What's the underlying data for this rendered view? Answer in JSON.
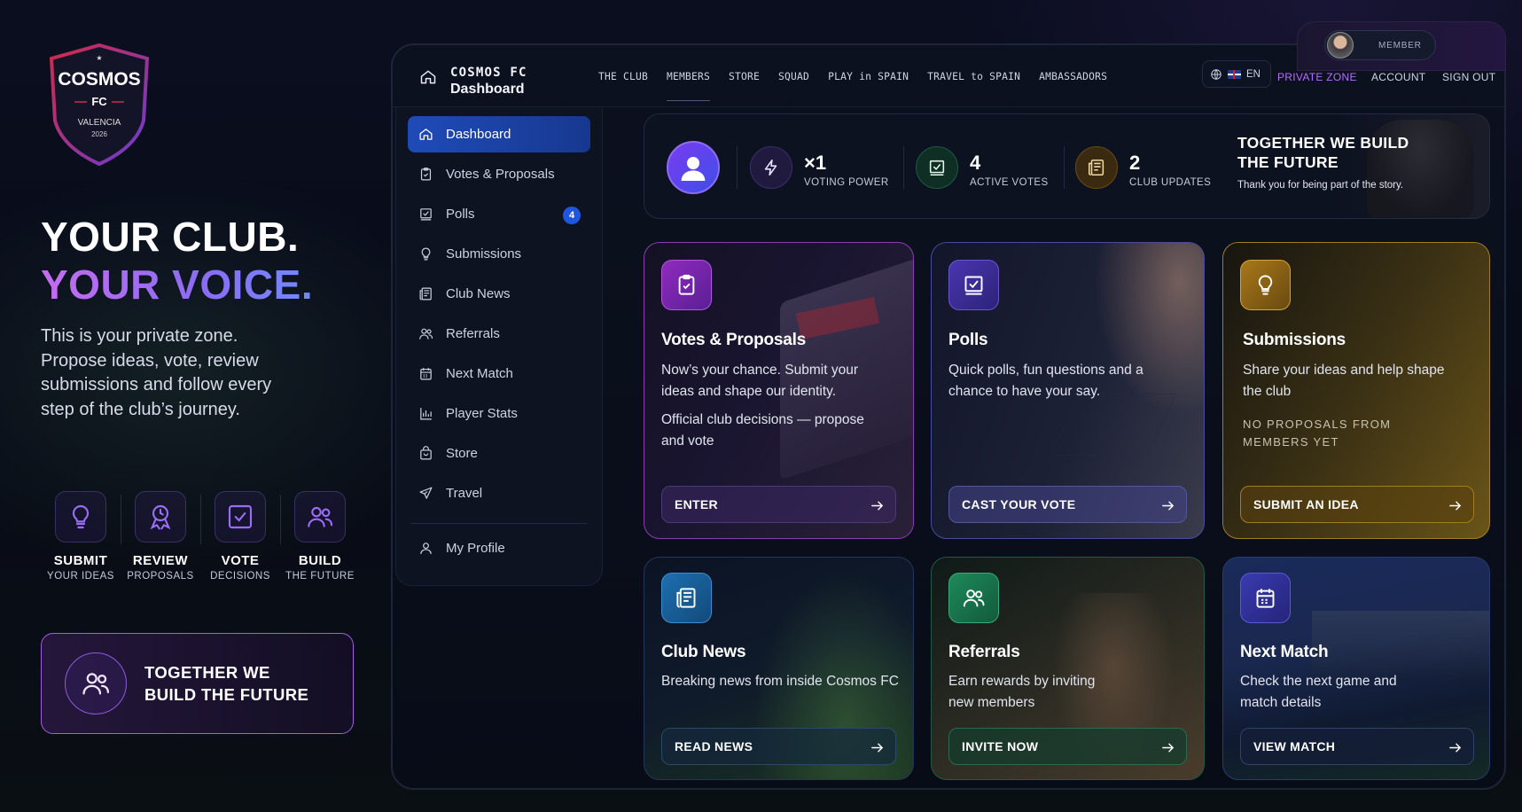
{
  "crest": {
    "name": "COSMOS",
    "fc": "FC",
    "city": "VALENCIA",
    "year": "2026"
  },
  "hero": {
    "line1": "YOUR CLUB.",
    "line2": "YOUR VOICE.",
    "description": "This is your private zone. Propose ideas, vote, review submissions and follow every step of the club’s journey."
  },
  "features": [
    {
      "title": "SUBMIT",
      "sub": "YOUR IDEAS",
      "icon": "lightbulb-icon"
    },
    {
      "title": "REVIEW",
      "sub": "PROPOSALS",
      "icon": "review-icon"
    },
    {
      "title": "VOTE",
      "sub": "DECISIONS",
      "icon": "vote-check-icon"
    },
    {
      "title": "BUILD",
      "sub": "THE FUTURE",
      "icon": "people-icon"
    }
  ],
  "together_card": {
    "text": "TOGETHER WE BUILD THE FUTURE",
    "icon": "people-icon"
  },
  "topbar": {
    "brand": "COSMOS FC",
    "brand_sub": "Dashboard",
    "nav": [
      "THE CLUB",
      "MEMBERS",
      "STORE",
      "SQUAD",
      "PLAY in SPAIN",
      "TRAVEL to SPAIN",
      "AMBASSADORS"
    ],
    "active_nav": "MEMBERS",
    "lang": "EN",
    "private_zone": "PRIVATE ZONE",
    "account": "ACCOUNT",
    "sign_out": "SIGN OUT",
    "member_label": "MEMBER"
  },
  "sidebar": {
    "items": [
      {
        "label": "Dashboard",
        "icon": "home-icon",
        "active": true
      },
      {
        "label": "Votes & Proposals",
        "icon": "clipboard-icon"
      },
      {
        "label": "Polls",
        "icon": "poll-icon",
        "badge": "4"
      },
      {
        "label": "Submissions",
        "icon": "lightbulb-icon"
      },
      {
        "label": "Club News",
        "icon": "newspaper-icon"
      },
      {
        "label": "Referrals",
        "icon": "users-icon"
      },
      {
        "label": "Next Match",
        "icon": "calendar-icon"
      },
      {
        "label": "Player Stats",
        "icon": "bar-chart-icon"
      },
      {
        "label": "Store",
        "icon": "bag-icon"
      },
      {
        "label": "Travel",
        "icon": "plane-icon"
      },
      {
        "label": "My Profile",
        "icon": "user-icon"
      }
    ]
  },
  "stats": {
    "voting_power": {
      "value": "×1",
      "label": "VOTING POWER"
    },
    "active_votes": {
      "value": "4",
      "label": "ACTIVE VOTES"
    },
    "club_updates": {
      "value": "2",
      "label": "CLUB UPDATES"
    },
    "banner_title": "TOGETHER WE BUILD THE FUTURE",
    "banner_sub": "Thank you for being part of the story."
  },
  "cards": {
    "votes": {
      "title": "Votes & Proposals",
      "desc": "Now’s your chance. Submit your ideas and shape our identity.",
      "desc2": "Official club decisions — propose and vote",
      "button": "ENTER"
    },
    "polls": {
      "title": "Polls",
      "desc": "Quick polls, fun questions and a chance to have your say.",
      "button": "CAST YOUR VOTE"
    },
    "submissions": {
      "title": "Submissions",
      "desc": "Share your ideas and help shape the club",
      "note": "NO PROPOSALS FROM MEMBERS YET",
      "button": "SUBMIT AN IDEA"
    },
    "news": {
      "title": "Club News",
      "desc": "Breaking news from inside Cosmos FC",
      "button": "READ NEWS"
    },
    "referrals": {
      "title": "Referrals",
      "desc": "Earn rewards by inviting new members",
      "button": "INVITE NOW"
    },
    "match": {
      "title": "Next Match",
      "desc": "Check the next game and match details",
      "button": "VIEW MATCH"
    }
  },
  "colors": {
    "accent_purple": "#a35be8",
    "accent_blue": "#1f4bb8",
    "gold": "#c9a227",
    "green": "#1d8a5a"
  }
}
